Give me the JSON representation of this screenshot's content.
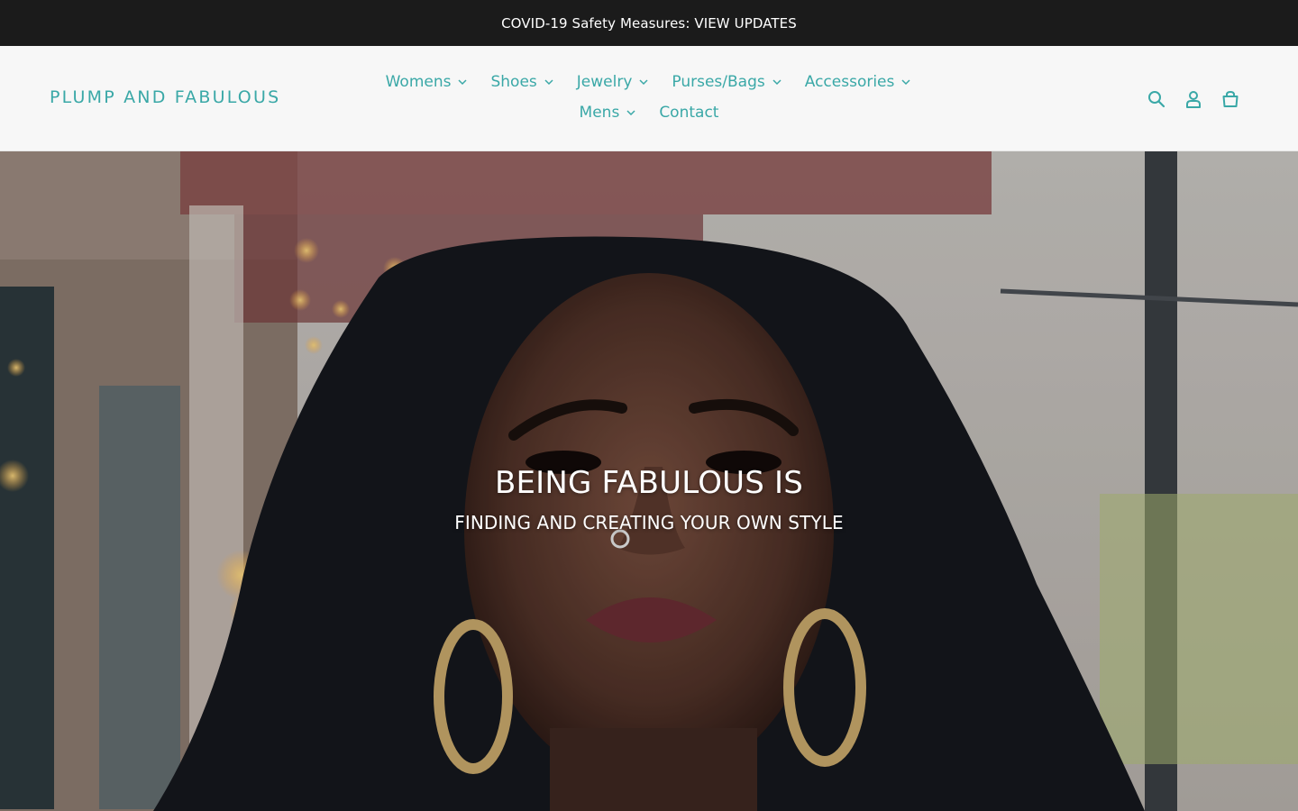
{
  "announcement": {
    "text": "COVID-19 Safety Measures: VIEW UPDATES"
  },
  "header": {
    "logo": "PLUMP AND FABULOUS",
    "nav": [
      {
        "label": "Womens",
        "has_dropdown": true
      },
      {
        "label": "Shoes",
        "has_dropdown": true
      },
      {
        "label": "Jewelry",
        "has_dropdown": true
      },
      {
        "label": "Purses/Bags",
        "has_dropdown": true
      },
      {
        "label": "Accessories",
        "has_dropdown": true
      },
      {
        "label": "Mens",
        "has_dropdown": true
      },
      {
        "label": "Contact",
        "has_dropdown": false
      }
    ],
    "icons": [
      "search-icon",
      "account-icon",
      "cart-icon"
    ]
  },
  "hero": {
    "title": "BEING FABULOUS IS",
    "subtitle": "FINDING AND CREATING YOUR OWN STYLE"
  },
  "colors": {
    "accent": "#3aa8a7",
    "announcement_bg": "#1b1b1b",
    "header_bg": "#f7f7f7"
  }
}
